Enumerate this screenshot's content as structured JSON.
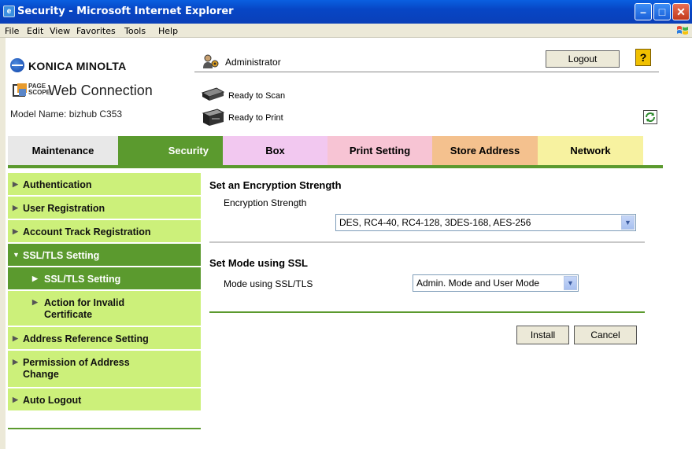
{
  "window": {
    "title": "Security - Microsoft Internet Explorer",
    "min_glyph": "–",
    "max_glyph": "□",
    "close_glyph": "✕"
  },
  "menu": [
    "File",
    "Edit",
    "View",
    "Favorites",
    "Tools",
    "Help"
  ],
  "header": {
    "brand": "KONICA MINOLTA",
    "pagescope": "PAGE SCOPE",
    "web_connection": "Web Connection",
    "model": "Model Name: bizhub C353",
    "user": "Administrator",
    "logout": "Logout",
    "help": "?",
    "scan_status": "Ready to Scan",
    "print_status": "Ready to Print"
  },
  "tabs": [
    {
      "label": "Maintenance",
      "color": "#e8e8e8"
    },
    {
      "label": "Security",
      "color": "#5b9a2e"
    },
    {
      "label": "Box",
      "color": "#f2c8f0"
    },
    {
      "label": "Print Setting",
      "color": "#f7c4d4"
    },
    {
      "label": "Store Address",
      "color": "#f4c18e"
    },
    {
      "label": "Network",
      "color": "#f7f2a0"
    }
  ],
  "sidebar": {
    "items": [
      {
        "label": "Authentication",
        "arrow": "▶"
      },
      {
        "label": "User Registration",
        "arrow": "▶"
      },
      {
        "label": "Account Track Registration",
        "arrow": "▶"
      },
      {
        "label": "SSL/TLS Setting",
        "arrow": "▼"
      },
      {
        "label": "SSL/TLS Setting",
        "arrow": "▶"
      },
      {
        "label": "Action for Invalid Certificate",
        "arrow": "▶"
      },
      {
        "label": "Address Reference Setting",
        "arrow": "▶"
      },
      {
        "label": "Permission of Address Change",
        "arrow": "▶"
      },
      {
        "label": "Auto Logout",
        "arrow": "▶"
      }
    ]
  },
  "main": {
    "encryption": {
      "title": "Set an Encryption Strength",
      "label": "Encryption Strength",
      "value": "DES, RC4-40, RC4-128, 3DES-168, AES-256"
    },
    "ssl_mode": {
      "title": "Set Mode using SSL",
      "label": "Mode using SSL/TLS",
      "value": "Admin. Mode and User Mode"
    },
    "install": "Install",
    "cancel": "Cancel",
    "dropdown_glyph": "▼"
  },
  "colors": {
    "accent_green": "#5b9a2e",
    "sidebar_light": "#ccf07a",
    "sidebar_selected": "#5b9a2e",
    "sidebar_sub": "#ccf07a"
  }
}
